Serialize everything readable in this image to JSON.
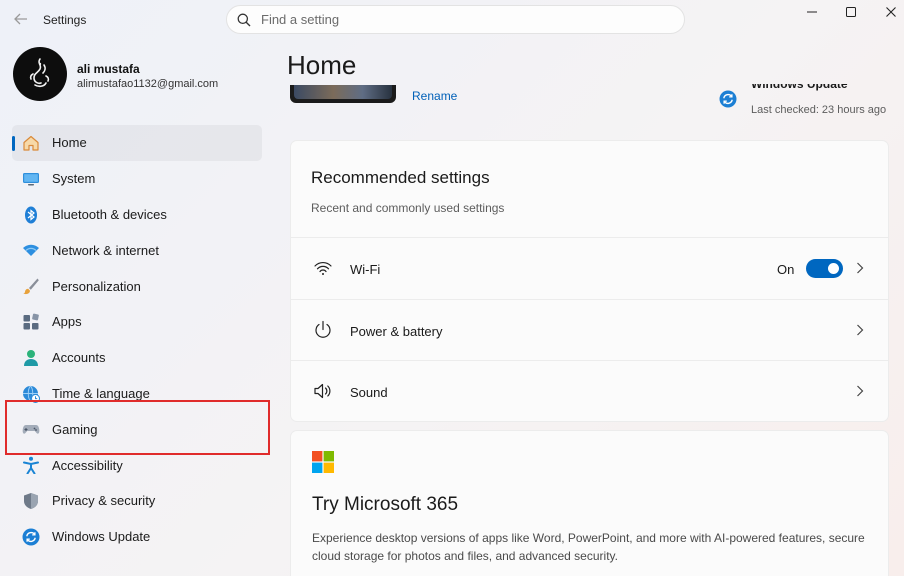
{
  "window": {
    "app_title": "Settings",
    "back_icon": "back-arrow-icon",
    "minimize_icon": "minimize-icon",
    "maximize_icon": "maximize-icon",
    "close_icon": "close-icon"
  },
  "search": {
    "placeholder": "Find a setting",
    "value": ""
  },
  "profile": {
    "name": "ali mustafa",
    "email": "alimustafao1132@gmail.com"
  },
  "sidebar": {
    "items": [
      {
        "label": "Home",
        "icon": "home-icon",
        "active": true
      },
      {
        "label": "System",
        "icon": "system-icon"
      },
      {
        "label": "Bluetooth & devices",
        "icon": "bluetooth-icon"
      },
      {
        "label": "Network & internet",
        "icon": "wifi-icon"
      },
      {
        "label": "Personalization",
        "icon": "brush-icon"
      },
      {
        "label": "Apps",
        "icon": "apps-icon"
      },
      {
        "label": "Accounts",
        "icon": "accounts-icon"
      },
      {
        "label": "Time & language",
        "icon": "globe-clock-icon"
      },
      {
        "label": "Gaming",
        "icon": "gamepad-icon",
        "highlighted": true
      },
      {
        "label": "Accessibility",
        "icon": "accessibility-icon"
      },
      {
        "label": "Privacy & security",
        "icon": "shield-icon"
      },
      {
        "label": "Windows Update",
        "icon": "update-icon"
      }
    ],
    "highlight_color": "#e02b2b"
  },
  "main": {
    "title": "Home",
    "device": {
      "rename_label": "Rename"
    },
    "windows_update": {
      "title": "Windows Update",
      "last_checked": "Last checked: 23 hours ago"
    },
    "recommended": {
      "title": "Recommended settings",
      "subtitle": "Recent and commonly used settings",
      "rows": [
        {
          "label": "Wi-Fi",
          "icon": "wifi-icon",
          "toggle_text": "On",
          "toggle_on": true
        },
        {
          "label": "Power & battery",
          "icon": "power-icon"
        },
        {
          "label": "Sound",
          "icon": "speaker-icon"
        }
      ]
    },
    "microsoft365": {
      "title": "Try Microsoft 365",
      "description": "Experience desktop versions of apps like Word, PowerPoint, and more with AI-powered features, secure cloud storage for photos and files, and advanced security."
    }
  },
  "colors": {
    "accent": "#0067c0",
    "link": "#0060b8"
  }
}
